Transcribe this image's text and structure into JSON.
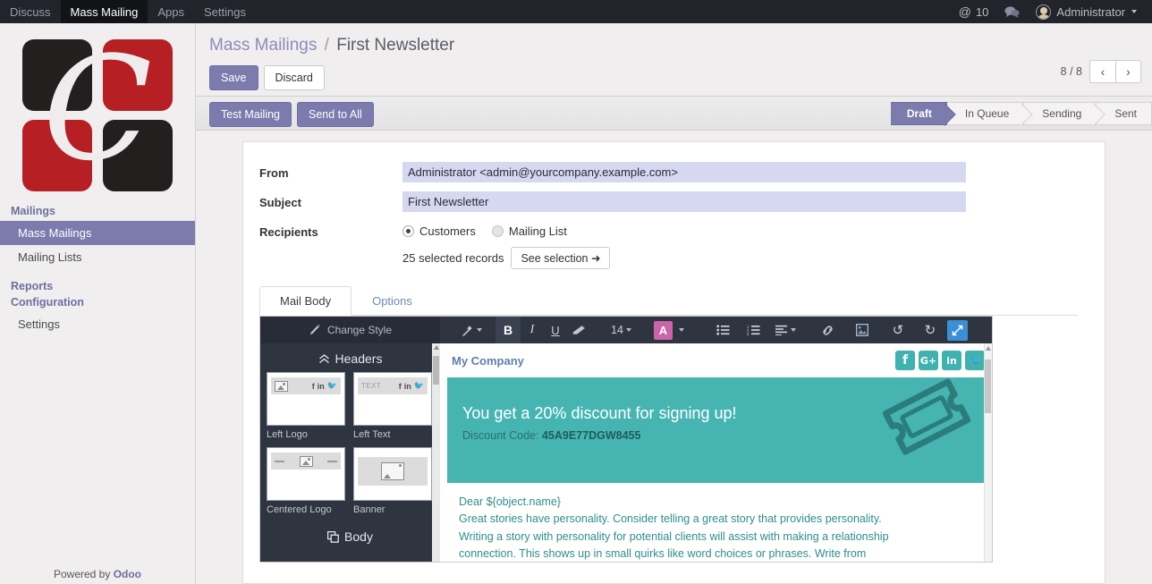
{
  "topbar": {
    "menus": [
      {
        "label": "Discuss",
        "active": false
      },
      {
        "label": "Mass Mailing",
        "active": true
      },
      {
        "label": "Apps",
        "active": false
      },
      {
        "label": "Settings",
        "active": false
      }
    ],
    "mention_count": "10",
    "mention_icon": "at-sign-icon",
    "chat_icon": "chat-bubble-icon",
    "user_name": "Administrator"
  },
  "sidebar": {
    "sections": [
      {
        "label": "Mailings",
        "type": "header"
      },
      {
        "label": "Mass Mailings",
        "type": "item",
        "active": true
      },
      {
        "label": "Mailing Lists",
        "type": "item",
        "active": false
      },
      {
        "label": "Reports",
        "type": "header"
      },
      {
        "label": "Configuration",
        "type": "header"
      },
      {
        "label": "Settings",
        "type": "item",
        "active": false
      }
    ],
    "footer_prefix": "Powered by ",
    "footer_brand": "Odoo"
  },
  "control_panel": {
    "breadcrumb_root": "Mass Mailings",
    "breadcrumb_sep": "/",
    "breadcrumb_current": "First Newsletter",
    "save_label": "Save",
    "discard_label": "Discard",
    "pager_count": "8 / 8",
    "prev_icon": "chevron-left-icon",
    "next_icon": "chevron-right-icon"
  },
  "actions": {
    "test_mailing_label": "Test Mailing",
    "send_to_all_label": "Send to All"
  },
  "statusbar": {
    "stages": [
      {
        "label": "Draft",
        "active": true
      },
      {
        "label": "In Queue",
        "active": false
      },
      {
        "label": "Sending",
        "active": false
      },
      {
        "label": "Sent",
        "active": false
      }
    ]
  },
  "form": {
    "from_label": "From",
    "from_value": "Administrator <admin@yourcompany.example.com>",
    "subject_label": "Subject",
    "subject_value": "First Newsletter",
    "subject_placeholder": "Subject",
    "recipients_label": "Recipients",
    "recipient_options": [
      {
        "label": "Customers",
        "selected": true
      },
      {
        "label": "Mailing List",
        "selected": false
      }
    ],
    "selected_records": "25 selected records",
    "see_selection_label": "See selection ➜"
  },
  "tabs": [
    {
      "label": "Mail Body",
      "active": true
    },
    {
      "label": "Options",
      "active": false
    }
  ],
  "editor": {
    "change_style_label": "Change Style",
    "change_style_icon": "paintbrush-icon",
    "font_size": "14",
    "toolbar": [
      {
        "name": "magic-wand-icon",
        "glyph": "✒",
        "caret": true,
        "active": false
      },
      {
        "name": "bold-icon",
        "glyph": "B",
        "caret": false,
        "active": true
      },
      {
        "name": "italic-icon",
        "glyph": "I",
        "caret": false,
        "active": false
      },
      {
        "name": "underline-icon",
        "glyph": "U",
        "caret": false,
        "active": false
      },
      {
        "name": "eraser-icon",
        "glyph": "▱",
        "caret": false,
        "active": false
      }
    ],
    "right_toolbar": [
      {
        "name": "unordered-list-icon"
      },
      {
        "name": "ordered-list-icon"
      },
      {
        "name": "align-left-icon"
      },
      {
        "name": "link-icon"
      },
      {
        "name": "insert-image-icon"
      },
      {
        "name": "undo-icon"
      },
      {
        "name": "redo-icon"
      },
      {
        "name": "expand-fullscreen-icon"
      }
    ],
    "snippets_panel": {
      "headers_label": "Headers",
      "headers_icon": "chevron-double-up-icon",
      "body_label": "Body",
      "body_icon": "layers-icon",
      "items": [
        {
          "label": "Left Logo",
          "kind": "logo-social"
        },
        {
          "label": "Left Text",
          "kind": "text-social",
          "text": "TEXT"
        },
        {
          "label": "Centered Logo",
          "kind": "centered-logo"
        },
        {
          "label": "Banner",
          "kind": "banner"
        }
      ],
      "social_glyphs": [
        "f",
        "in",
        "🐦"
      ]
    }
  },
  "mail_preview": {
    "company": "My Company",
    "social_icons": [
      {
        "name": "facebook-icon",
        "glyph": "f"
      },
      {
        "name": "google-plus-icon",
        "glyph": "G+"
      },
      {
        "name": "linkedin-icon",
        "glyph": "in"
      },
      {
        "name": "twitter-icon",
        "glyph": "🐦"
      }
    ],
    "banner": {
      "headline": "You get a 20% discount for signing up!",
      "code_label": "Discount Code:",
      "code_value": "45A9E77DGW8455",
      "icon": "ticket-icon"
    },
    "body": [
      "Dear ${object.name}",
      "Great stories have personality. Consider telling a great story that provides personality.",
      "Writing a story with personality for potential clients will assist with making a relationship",
      "connection. This shows up in small quirks like word choices or phrases. Write from"
    ]
  },
  "colors": {
    "brand_purple": "#7c7bad",
    "navbar_dark": "#21252b",
    "editor_dark": "#2e3440",
    "teal": "#46b5b2",
    "teal_dark": "#2c6f6d",
    "field_bg": "#d6d8f2",
    "accent_pink": "#c965a8",
    "accent_blue": "#3b8fd4",
    "logo_red": "#b61f24",
    "logo_black": "#221f1f"
  }
}
